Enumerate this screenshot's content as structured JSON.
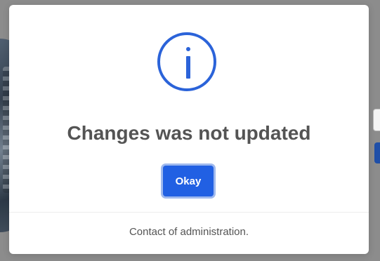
{
  "modal": {
    "icon": "info-icon",
    "title": "Changes was not updated",
    "confirm_label": "Okay",
    "footer_text": "Contact of administration."
  },
  "colors": {
    "accent": "#2b63d9",
    "button": "#2160e3",
    "text": "#545454",
    "backdrop": "#8c8c8c"
  }
}
